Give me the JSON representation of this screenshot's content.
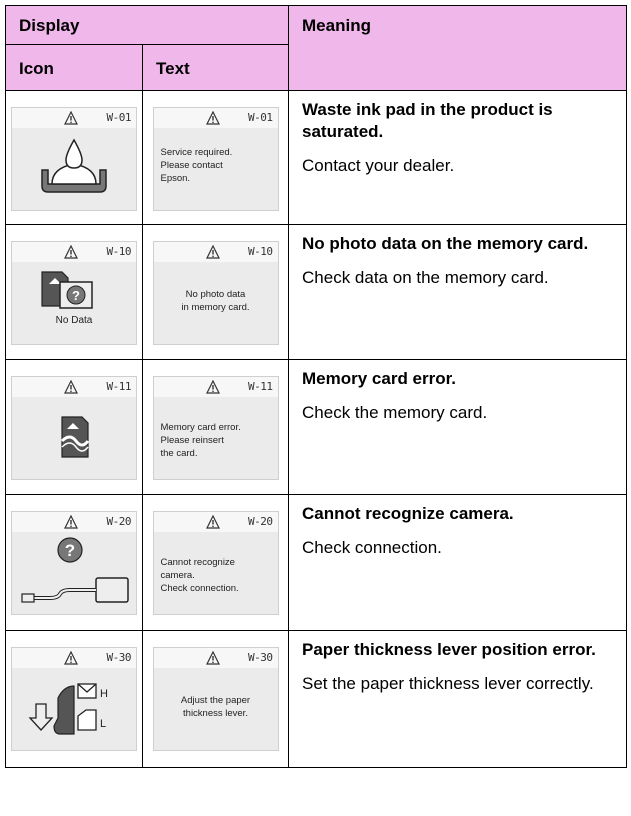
{
  "header": {
    "display": "Display",
    "meaning": "Meaning",
    "icon": "Icon",
    "text": "Text"
  },
  "rows": [
    {
      "code": "W-01",
      "icon_caption": "",
      "icon_name": "waste-ink-pad-icon",
      "screen_text": [
        "Service required.",
        "Please contact",
        "Epson."
      ],
      "title": "Waste ink pad in the product is saturated.",
      "action": "Contact your dealer."
    },
    {
      "code": "W-10",
      "icon_caption": "No Data",
      "icon_name": "no-photo-data-icon",
      "screen_text": [
        "No photo data",
        "in memory card."
      ],
      "title": "No photo data on the memory card.",
      "action": "Check data on the memory card."
    },
    {
      "code": "W-11",
      "icon_caption": "",
      "icon_name": "memory-card-error-icon",
      "screen_text": [
        "Memory card error.",
        "Please reinsert",
        "the card."
      ],
      "title": "Memory card error.",
      "action": "Check the memory card."
    },
    {
      "code": "W-20",
      "icon_caption": "",
      "icon_name": "camera-connection-icon",
      "screen_text": [
        "Cannot recognize",
        "camera.",
        "Check connection."
      ],
      "title": "Cannot recognize camera.",
      "action": "Check connection."
    },
    {
      "code": "W-30",
      "icon_caption": "",
      "icon_name": "paper-thickness-lever-icon",
      "screen_text": [
        "Adjust the paper",
        "thickness lever."
      ],
      "title": "Paper thickness lever position error.",
      "action": "Set the paper thickness lever correctly.",
      "lever_labels": [
        "H",
        "L"
      ]
    }
  ],
  "colors": {
    "header_bg": "#f0b7ea",
    "screen_bg": "#ebebeb"
  }
}
